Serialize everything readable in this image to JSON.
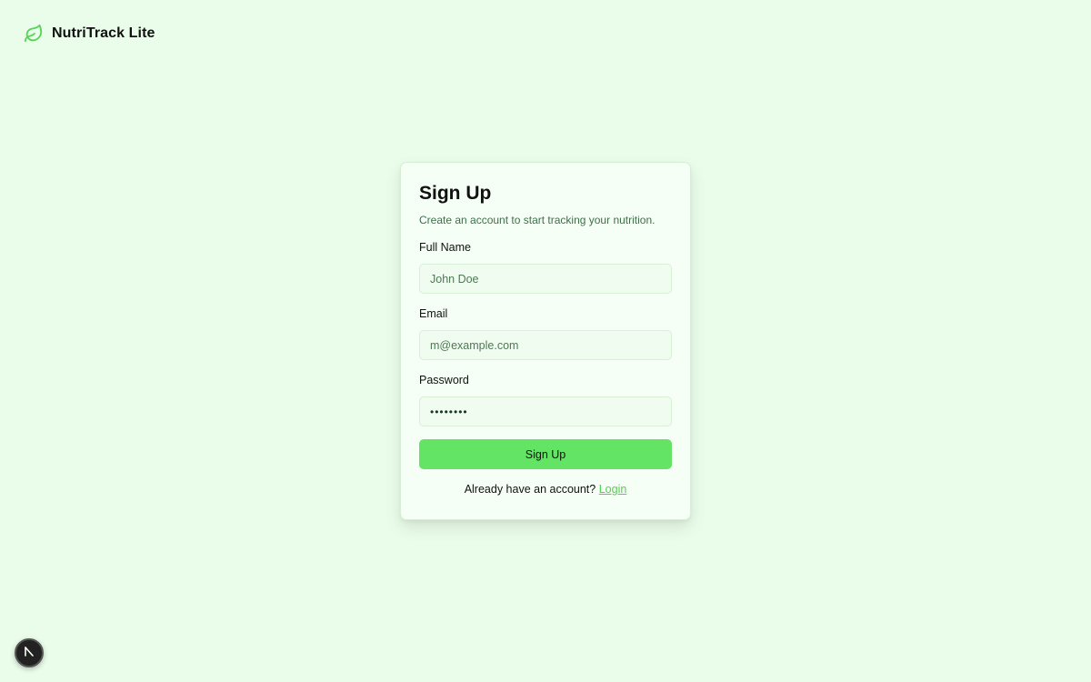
{
  "app": {
    "brand": "NutriTrack Lite",
    "logo_icon": "leaf-icon",
    "accent": "#64e464"
  },
  "signup": {
    "title": "Sign Up",
    "subtitle": "Create an account to start tracking your nutrition.",
    "fields": {
      "name": {
        "label": "Full Name",
        "placeholder": "John Doe",
        "value": ""
      },
      "email": {
        "label": "Email",
        "placeholder": "m@example.com",
        "value": ""
      },
      "password": {
        "label": "Password",
        "value": "password"
      }
    },
    "submit_label": "Sign Up",
    "footer_text": "Already have an account?",
    "login_label": "Login"
  },
  "dev_badge": {
    "icon": "nextjs-icon"
  }
}
